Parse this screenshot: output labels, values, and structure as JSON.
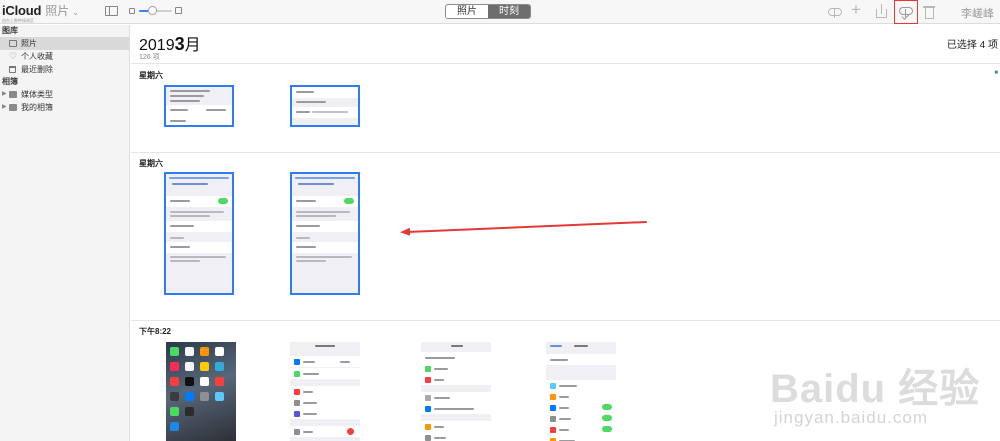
{
  "app": {
    "brand": "iCloud",
    "name": "照片",
    "subtitle": "由台上数种接收区"
  },
  "toolbar": {
    "view_tabs": [
      {
        "label": "照片",
        "active": false
      },
      {
        "label": "时刻",
        "active": true
      }
    ],
    "icons": [
      "upload-cloud-icon",
      "add-icon",
      "share-icon",
      "download-cloud-icon",
      "trash-icon"
    ],
    "highlighted_icon": "download-cloud-icon",
    "user_name": "李嵯峰"
  },
  "sidebar": {
    "library_header": "图库",
    "library_items": [
      {
        "label": "照片",
        "icon": "photos-icon",
        "selected": true
      },
      {
        "label": "个人收藏",
        "icon": "heart-icon",
        "selected": false
      },
      {
        "label": "最近删除",
        "icon": "trash-icon",
        "selected": false
      }
    ],
    "albums_header": "相簿",
    "album_items": [
      {
        "label": "媒体类型",
        "icon": "folder-icon"
      },
      {
        "label": "我的相簿",
        "icon": "folder-icon"
      }
    ]
  },
  "main": {
    "year": "2019",
    "month_num": "3",
    "month_unit": "月",
    "count": "126 项",
    "selected_count": "已选择 4 项",
    "sections": [
      {
        "label": "星期六"
      },
      {
        "label": "星期六"
      },
      {
        "label": "下午8:22"
      }
    ]
  },
  "colors": {
    "selection_blue": "#2e7cf6",
    "annotation_red": "#e53935",
    "toggle_green": "#4cd964"
  },
  "watermark": {
    "brand": "Baidu 经验",
    "url": "jingyan.baidu.com"
  }
}
